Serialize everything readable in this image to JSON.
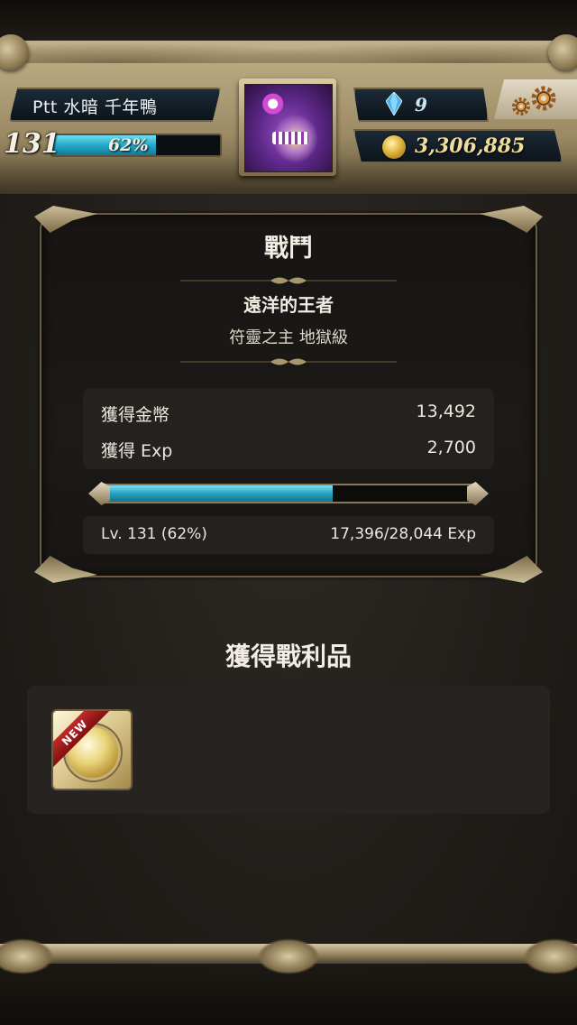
{
  "header": {
    "player_name": "Ptt 水暗 千年鴨",
    "level": "131",
    "exp_percent_label": "62%",
    "exp_fraction": 0.62,
    "gems": "9",
    "gold": "3,306,885"
  },
  "battle": {
    "title": "戰鬥",
    "stage_name": "遠洋的王者",
    "stage_sub": "符靈之主 地獄級",
    "rewards": [
      {
        "label": "獲得金幣",
        "value": "13,492"
      },
      {
        "label": "獲得 Exp",
        "value": "2,700"
      }
    ],
    "progress_fraction": 0.62,
    "level_text": "Lv. 131 (62%)",
    "exp_text": "17,396/28,044 Exp"
  },
  "loot": {
    "title": "獲得戰利品",
    "items": [
      {
        "badge": "NEW",
        "icon": "gold-medal-icon"
      }
    ]
  },
  "colors": {
    "exp_bar": "#2aa7c4",
    "frame_gold": "#b7a77f",
    "panel_bg": "#1c1a17"
  }
}
